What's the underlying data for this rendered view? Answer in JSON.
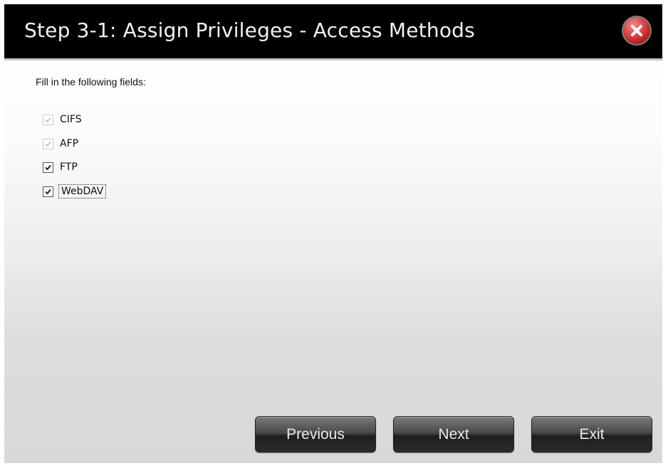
{
  "dialog": {
    "title": "Step 3-1: Assign Privileges - Access Methods",
    "close_icon": "close-icon"
  },
  "form": {
    "intro": "Fill in the following fields:",
    "options": [
      {
        "label": "CIFS",
        "checked": true,
        "disabled": true
      },
      {
        "label": "AFP",
        "checked": true,
        "disabled": true
      },
      {
        "label": "FTP",
        "checked": true,
        "disabled": false
      },
      {
        "label": "WebDAV",
        "checked": true,
        "disabled": false,
        "focused": true
      }
    ]
  },
  "buttons": {
    "previous": "Previous",
    "next": "Next",
    "exit": "Exit"
  },
  "colors": {
    "titlebar": "#000000",
    "close_red": "#c62828",
    "button_dark": "#2b2b2b"
  }
}
